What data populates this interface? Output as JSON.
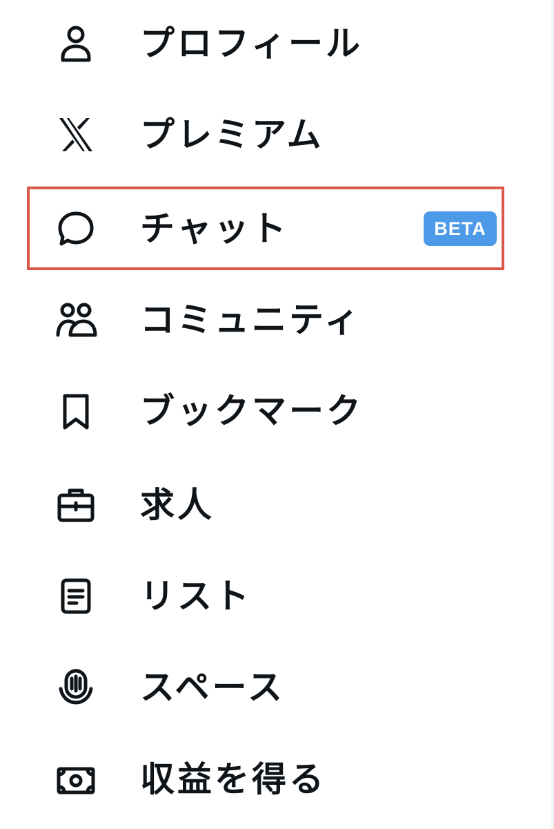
{
  "menu": {
    "items": [
      {
        "label": "プロフィール",
        "icon": "profile-icon"
      },
      {
        "label": "プレミアム",
        "icon": "x-logo-icon"
      },
      {
        "label": "チャット",
        "icon": "chat-bubble-icon",
        "badge": "BETA",
        "highlighted": true
      },
      {
        "label": "コミュニティ",
        "icon": "communities-icon"
      },
      {
        "label": "ブックマーク",
        "icon": "bookmark-icon"
      },
      {
        "label": "求人",
        "icon": "briefcase-icon"
      },
      {
        "label": "リスト",
        "icon": "list-icon"
      },
      {
        "label": "スペース",
        "icon": "spaces-microphone-icon"
      },
      {
        "label": "収益を得る",
        "icon": "money-icon"
      }
    ]
  },
  "colors": {
    "text": "#0f1419",
    "badge_background": "#4d9ae8",
    "badge_text": "#ffffff",
    "highlight_border": "#d9584a"
  }
}
